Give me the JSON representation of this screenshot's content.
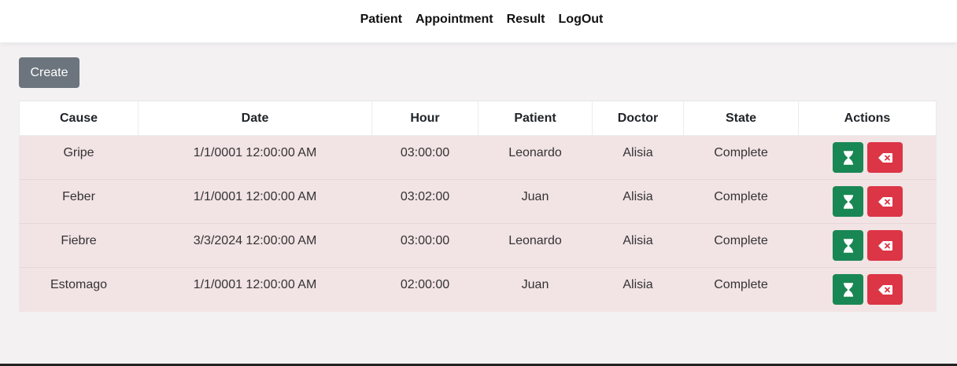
{
  "nav": {
    "items": [
      "Patient",
      "Appointment",
      "Result",
      "LogOut"
    ]
  },
  "toolbar": {
    "create_label": "Create"
  },
  "table": {
    "headers": [
      "Cause",
      "Date",
      "Hour",
      "Patient",
      "Doctor",
      "State",
      "Actions"
    ],
    "rows": [
      [
        "Gripe",
        "1/1/0001 12:00:00 AM",
        "03:00:00",
        "Leonardo",
        "Alisia",
        "Complete"
      ],
      [
        "Feber",
        "1/1/0001 12:00:00 AM",
        "03:02:00",
        "Juan",
        "Alisia",
        "Complete"
      ],
      [
        "Fiebre",
        "3/3/2024 12:00:00 AM",
        "03:00:00",
        "Leonardo",
        "Alisia",
        "Complete"
      ],
      [
        "Estomago",
        "1/1/0001 12:00:00 AM",
        "02:00:00",
        "Juan",
        "Alisia",
        "Complete"
      ]
    ],
    "row_actions": [
      {
        "name": "complete-button",
        "icon": "hourglass-icon",
        "color": "#198754"
      },
      {
        "name": "delete-button",
        "icon": "backspace-icon",
        "color": "#dc3545"
      }
    ]
  },
  "colors": {
    "row_background": "#f2e3e5",
    "page_background": "#f3f1f2",
    "create_button": "#6c757d"
  }
}
